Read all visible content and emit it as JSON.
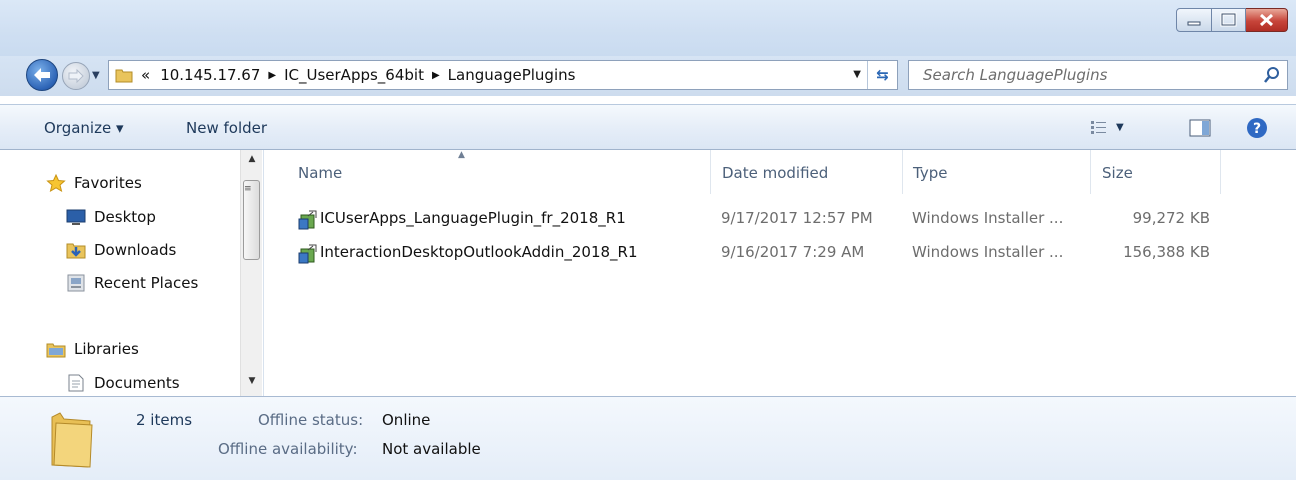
{
  "window": {
    "buttons": {
      "minimize": "minimize",
      "maximize": "maximize",
      "close": "close"
    }
  },
  "address_bar": {
    "overflow_chevron": "«",
    "crumbs": [
      "10.145.17.67",
      "IC_UserApps_64bit",
      "LanguagePlugins"
    ],
    "separator": "▶"
  },
  "search": {
    "placeholder": "Search LanguagePlugins"
  },
  "toolbar": {
    "organize_label": "Organize ▾",
    "new_folder_label": "New folder"
  },
  "nav_pane": {
    "favorites": {
      "label": "Favorites",
      "icon": "star-icon"
    },
    "favorite_items": [
      {
        "label": "Desktop",
        "icon": "desktop-icon"
      },
      {
        "label": "Downloads",
        "icon": "downloads-icon"
      },
      {
        "label": "Recent Places",
        "icon": "recent-places-icon"
      }
    ],
    "libraries": {
      "label": "Libraries",
      "icon": "libraries-icon"
    },
    "library_items": [
      {
        "label": "Documents",
        "icon": "documents-icon"
      }
    ]
  },
  "file_list": {
    "columns": [
      "Name",
      "Date modified",
      "Type",
      "Size"
    ],
    "rows": [
      {
        "name": "ICUserApps_LanguagePlugin_fr_2018_R1",
        "date": "9/17/2017 12:57 PM",
        "type": "Windows Installer ...",
        "size": "99,272 KB",
        "icon": "installer-icon"
      },
      {
        "name": "InteractionDesktopOutlookAddin_2018_R1",
        "date": "9/16/2017 7:29 AM",
        "type": "Windows Installer ...",
        "size": "156,388 KB",
        "icon": "installer-icon"
      }
    ]
  },
  "details": {
    "item_count": "2 items",
    "offline_status_label": "Offline status:",
    "offline_status_value": "Online",
    "offline_availability_label": "Offline availability:",
    "offline_availability_value": "Not available"
  },
  "colors": {
    "titlebar": "#cfdff2",
    "accent": "#1e395b",
    "close": "#c7453a"
  }
}
